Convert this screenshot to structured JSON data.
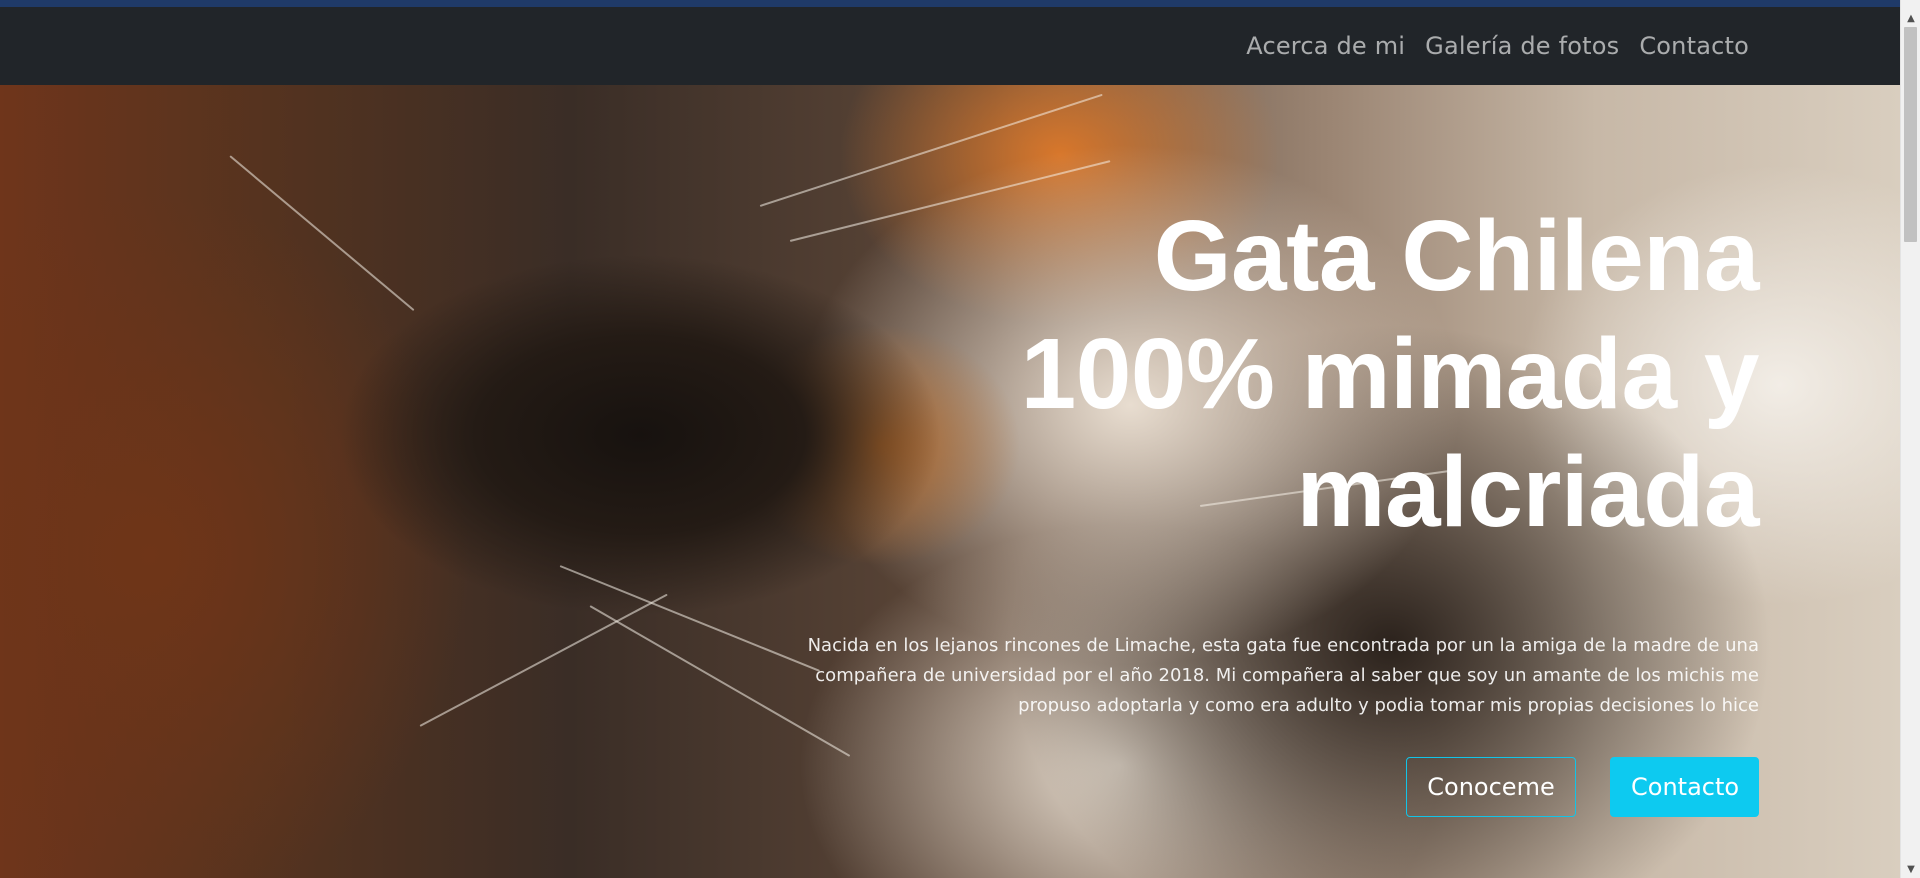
{
  "nav": {
    "links": [
      "Acerca de mi",
      "Galería de fotos",
      "Contacto"
    ]
  },
  "hero": {
    "title_lines": [
      "Gata Chilena",
      "100% mimada y",
      "malcriada"
    ],
    "text": "Nacida en los lejanos rincones de Limache, esta gata fue encontrada por un la amiga de la madre de una compañera de universidad por el año 2018. Mi compañera al saber que soy un amante de los michis me propuso adoptarla y como era adulto y podia tomar mis propias decisiones lo hice",
    "buttons": {
      "primary": "Conoceme",
      "secondary": "Contacto"
    }
  },
  "colors": {
    "navbar": "#212529",
    "accent": "#0dcaf0",
    "strip": "#1f3a68"
  },
  "scrollbar": {
    "up_icon": "scroll-up-arrow-icon",
    "down_icon": "scroll-down-arrow-icon"
  }
}
